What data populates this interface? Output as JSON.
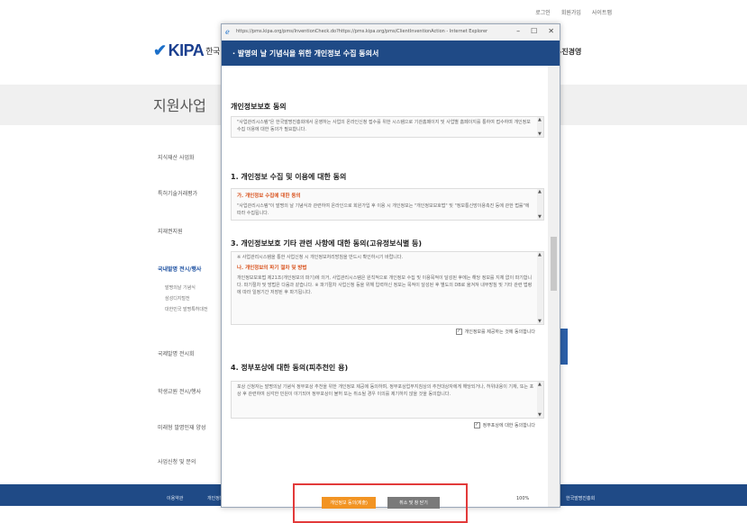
{
  "site": {
    "top_links": [
      "로그인",
      "회원가입",
      "사이트맵"
    ],
    "logo_text": "KIPA",
    "logo_sub": "한국",
    "right_header_text": "-진경영",
    "page_title": "지원사업",
    "side_menu": [
      "지식재산 사업화",
      "특허기술거래평가",
      "지재권지원",
      "국내발명 전시/행사",
      "국제발명 전시회",
      "학생교원 전시/행사",
      "미래형 발명인재 양성",
      "사업신청 및 문의"
    ],
    "side_submenu": [
      "발명의날 기념식",
      "삼성디지털전",
      "대한민국 발명특허대전"
    ],
    "footer_links": [
      "이용약관",
      "개인정보",
      "한국발명진흥회"
    ]
  },
  "popup": {
    "url": "https://pms.kipa.org/pms/InventionCheck.do?https://pms.kipa.org/pms/ClientInventionAction - Internet Explorer",
    "title": "· 발명의 날 기념식을 위한 개인정보 수집 동의서",
    "sections": [
      {
        "heading": "개인정보보호 동의",
        "body": "\"사업관리시스템\"은 한국발명진흥회에서 운영하는 사업의 온라인신청 접수를 위한 시스템으로 기관홈페이지 및 사업별 홈페이지를 통하여 접수하며 개인정보 수집 이용에 대한 동의가 필요합니다.",
        "red": ""
      },
      {
        "heading": "1. 개인정보 수집 및 이용에 대한 동의",
        "body": "\"사업관리시스템\"이 발명의 날 기념식과 관련하여 온라인으로 회원가입 후 이용 시 개인정보는 \"개인정보보호법\" 및 \"정보통신망이용촉진 등에 관한 법률\"에 따라 수집됩니다.",
        "red": "가. 개인정보 수집에 대한 동의"
      },
      {
        "heading": "3. 개인정보보호 기타 관련 사항에 대한 동의(고유정보식별 등)",
        "intro": "※ 사업관리시스템을 통한 사업신청 시 개인정보처리방침을 반드시 확인하시기 바랍니다.",
        "red": "나. 개인정보의 파기 절차 및 방법",
        "body": "개인정보보호법 제21조(개인정보의 파기)에 의거, 사업관리시스템은 원칙적으로 개인정보 수집 및 이용목적이 달성된 후에는 해당 정보를 지체 없이 파기합니다. 파기절차 및 방법은 다음과 같습니다. ※ 파기절차 사업신청 등을 위해 입력하신 정보는 목적이 달성된 후 별도의 DB로 옮겨져 내부방침 및 기타 관련 법령에 따라 일정기간 저장된 후 파기됩니다.",
        "agree": "개인정보를 제공하는 것에 동의합니다"
      },
      {
        "heading": "4. 정부포상에 대한 동의(피추천인 용)",
        "body": "포상 신청자는 발명의날 기념식 정부포상 추천을 위한 개인정보 제공에 동의하며, 정부포상업무지침상의 추천대상자에게 해당되거나, 허위내용이 기재, 또는 포상 후 관련하여 심각한 민원이 야기되어 정부포상이 불허 또는 취소될 경우 이의를 제기하지 않을 것을 동의합니다.",
        "agree": "정부포상에 대한 동의합니다"
      }
    ],
    "btn_confirm": "개인정보 동의(제출)",
    "btn_cancel": "취소 및 창 닫기",
    "zoom": "100%"
  }
}
